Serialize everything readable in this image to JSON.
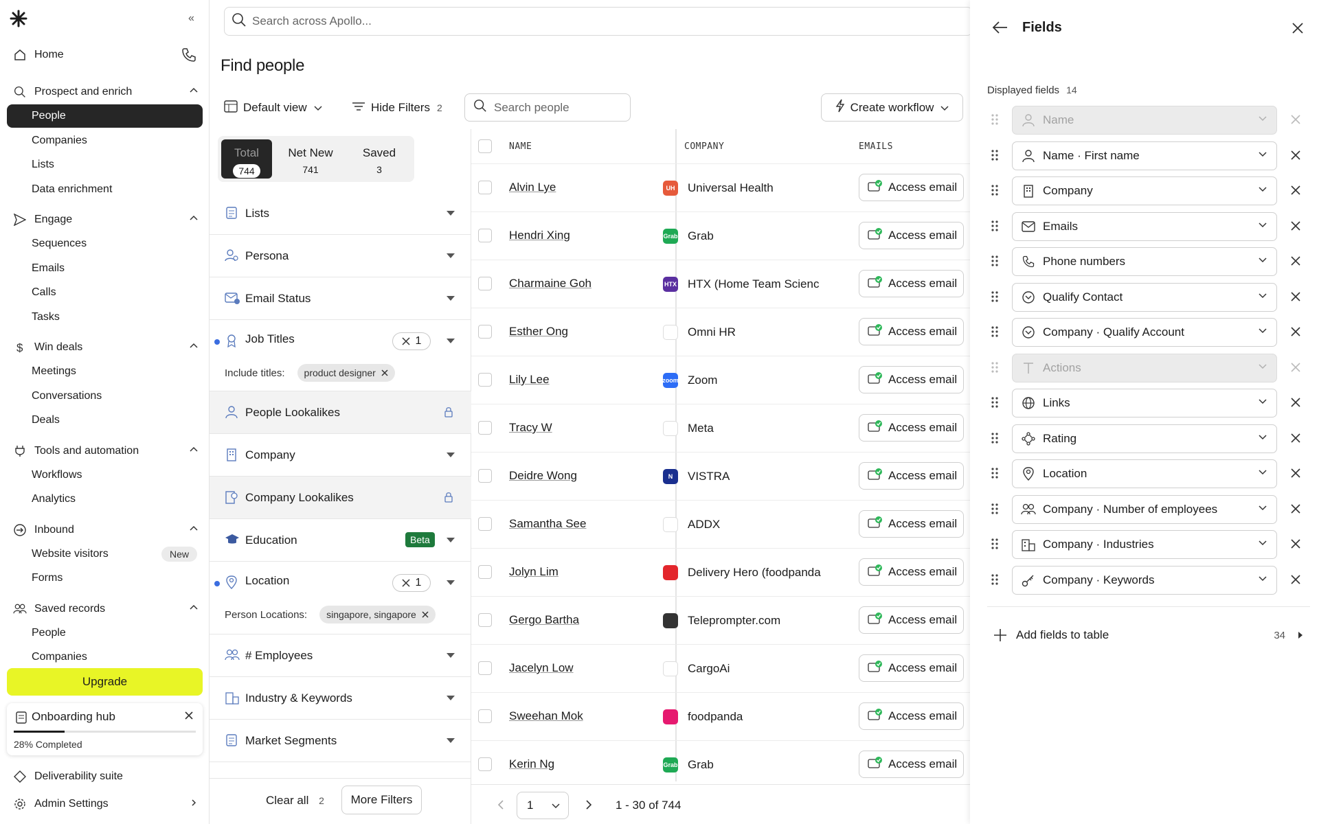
{
  "sidebar": {
    "home": "Home",
    "sections": [
      {
        "label": "Prospect and enrich",
        "icon": "search-icon",
        "items": [
          "People",
          "Companies",
          "Lists",
          "Data enrichment"
        ]
      },
      {
        "label": "Engage",
        "icon": "send-icon",
        "items": [
          "Sequences",
          "Emails",
          "Calls",
          "Tasks"
        ]
      },
      {
        "label": "Win deals",
        "icon": "dollar-icon",
        "items": [
          "Meetings",
          "Conversations",
          "Deals"
        ]
      },
      {
        "label": "Tools and automation",
        "icon": "plug-icon",
        "items": [
          "Workflows",
          "Analytics"
        ]
      },
      {
        "label": "Inbound",
        "icon": "inbound-icon",
        "items": [
          "Website visitors",
          "Forms"
        ]
      },
      {
        "label": "Saved records",
        "icon": "users-icon",
        "items": [
          "People",
          "Companies"
        ]
      }
    ],
    "new_badge": "New",
    "upgrade": "Upgrade",
    "onboarding": {
      "title": "Onboarding hub",
      "progress_text": "28% Completed",
      "progress": 0.28
    },
    "deliverability": "Deliverability suite",
    "admin": "Admin Settings"
  },
  "search": {
    "placeholder": "Search across Apollo..."
  },
  "page": {
    "title": "Find people"
  },
  "toolbar": {
    "default_view": "Default view",
    "hide_filters": "Hide Filters",
    "hide_filters_count": "2",
    "search_people": "Search people",
    "create_workflow": "Create workflow"
  },
  "tabs": [
    {
      "label": "Total",
      "count": "744"
    },
    {
      "label": "Net New",
      "count": "741"
    },
    {
      "label": "Saved",
      "count": "3"
    }
  ],
  "filters": {
    "lists": "Lists",
    "persona": "Persona",
    "email_status": "Email Status",
    "job_titles": "Job Titles",
    "job_titles_count": "1",
    "include_titles_label": "Include titles:",
    "include_titles_chip": "product designer",
    "people_lookalikes": "People Lookalikes",
    "company": "Company",
    "company_lookalikes": "Company Lookalikes",
    "education": "Education",
    "beta": "Beta",
    "location": "Location",
    "location_count": "1",
    "person_locations_label": "Person Locations:",
    "person_locations_chip": "singapore, singapore",
    "employees": "# Employees",
    "industry": "Industry & Keywords",
    "market_segments": "Market Segments",
    "clear_all": "Clear all",
    "clear_all_count": "2",
    "more_filters": "More Filters"
  },
  "table": {
    "headers": {
      "name": "NAME",
      "company": "COMPANY",
      "emails": "EMAILS"
    },
    "access_label": "Access email",
    "rows": [
      {
        "name": "Alvin Lye",
        "company": "Universal Health",
        "logo_color": "#e65a3b",
        "logo_text": "UH"
      },
      {
        "name": "Hendri Xing",
        "company": "Grab",
        "logo_color": "#1ea954",
        "logo_text": "Grab"
      },
      {
        "name": "Charmaine Goh",
        "company": "HTX (Home Team Scienc",
        "logo_color": "#5a2fa0",
        "logo_text": "HTX"
      },
      {
        "name": "Esther Ong",
        "company": "Omni HR",
        "logo_color": "#ffffff",
        "logo_text": ""
      },
      {
        "name": "Lily Lee",
        "company": "Zoom",
        "logo_color": "#2d6df6",
        "logo_text": "zoom"
      },
      {
        "name": "Tracy W",
        "company": "Meta",
        "logo_color": "#ffffff",
        "logo_text": ""
      },
      {
        "name": "Deidre Wong",
        "company": "VISTRA",
        "logo_color": "#1a2f8f",
        "logo_text": "N"
      },
      {
        "name": "Samantha See",
        "company": "ADDX",
        "logo_color": "#ffffff",
        "logo_text": ""
      },
      {
        "name": "Jolyn Lim",
        "company": "Delivery Hero (foodpanda",
        "logo_color": "#e3262c",
        "logo_text": ""
      },
      {
        "name": "Gergo Bartha",
        "company": "Teleprompter.com",
        "logo_color": "#333333",
        "logo_text": ""
      },
      {
        "name": "Jacelyn Low",
        "company": "CargoAi",
        "logo_color": "#ffffff",
        "logo_text": ""
      },
      {
        "name": "Sweehan Mok",
        "company": "foodpanda",
        "logo_color": "#e6196f",
        "logo_text": ""
      },
      {
        "name": "Kerin Ng",
        "company": "Grab",
        "logo_color": "#1ea954",
        "logo_text": "Grab"
      }
    ]
  },
  "pager": {
    "page": "1",
    "range": "1 - 30 of 744"
  },
  "fields_panel": {
    "title": "Fields",
    "displayed_label": "Displayed fields",
    "displayed_count": "14",
    "fields": [
      {
        "label": "Name",
        "icon": "person-icon",
        "disabled": true
      },
      {
        "label": "Name · First name",
        "icon": "person-icon",
        "disabled": false
      },
      {
        "label": "Company",
        "icon": "building-icon",
        "disabled": false
      },
      {
        "label": "Emails",
        "icon": "mail-icon",
        "disabled": false
      },
      {
        "label": "Phone numbers",
        "icon": "phone-icon",
        "disabled": false
      },
      {
        "label": "Qualify Contact",
        "icon": "qualify-icon",
        "disabled": false
      },
      {
        "label": "Company · Qualify Account",
        "icon": "qualify-icon",
        "disabled": false
      },
      {
        "label": "Actions",
        "icon": "text-icon",
        "disabled": true
      },
      {
        "label": "Links",
        "icon": "globe-icon",
        "disabled": false
      },
      {
        "label": "Rating",
        "icon": "rating-icon",
        "disabled": false
      },
      {
        "label": "Location",
        "icon": "pin-icon",
        "disabled": false
      },
      {
        "label": "Company · Number of employees",
        "icon": "users-icon",
        "disabled": false
      },
      {
        "label": "Company · Industries",
        "icon": "industry-icon",
        "disabled": false
      },
      {
        "label": "Company · Keywords",
        "icon": "key-icon",
        "disabled": false
      }
    ],
    "add_fields": "Add fields to table",
    "add_fields_count": "34"
  }
}
